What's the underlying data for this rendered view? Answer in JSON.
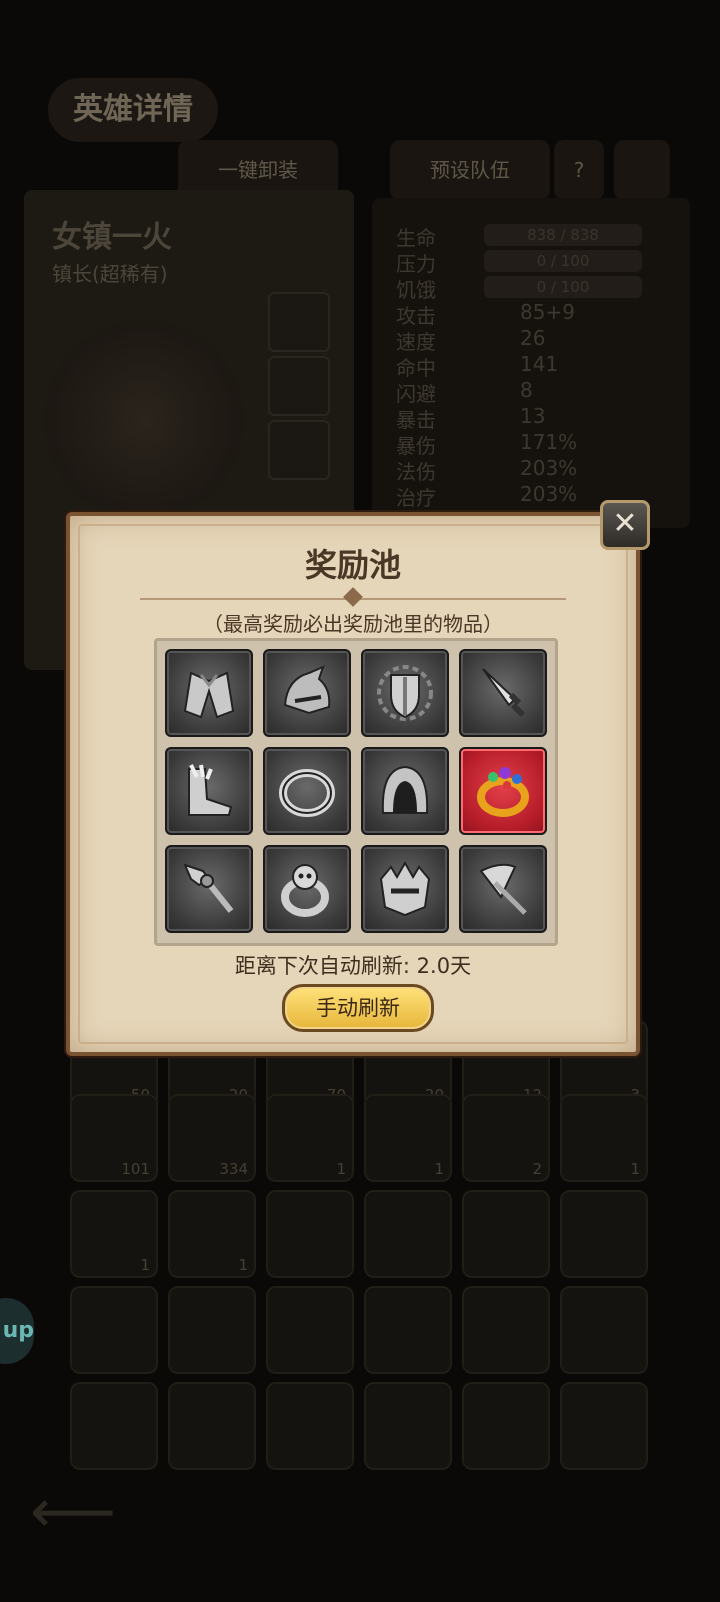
{
  "background": {
    "page_title": "英雄详情",
    "buttons": {
      "equip_all": "一键卸装",
      "preset_team": "预设队伍",
      "help": "?"
    },
    "hero": {
      "name": "女镇一火",
      "rank": "镇长(超稀有)"
    },
    "stats": [
      {
        "label": "生命",
        "value": "838 / 838"
      },
      {
        "label": "压力",
        "value": "0 / 100"
      },
      {
        "label": "饥饿",
        "value": "0 / 100"
      },
      {
        "label": "攻击",
        "value": "85+9"
      },
      {
        "label": "速度",
        "value": "26"
      },
      {
        "label": "命中",
        "value": "141"
      },
      {
        "label": "闪避",
        "value": "8"
      },
      {
        "label": "暴击",
        "value": "13"
      },
      {
        "label": "暴伤",
        "value": "171%"
      },
      {
        "label": "法伤",
        "value": "203%"
      },
      {
        "label": "治疗",
        "value": "203%"
      }
    ],
    "inventory_counts": [
      "50",
      "20",
      "70",
      "20",
      "12",
      "3",
      "101",
      "334",
      "1",
      "1",
      "2",
      "1",
      "1",
      "1"
    ],
    "side_pill": "up"
  },
  "dialog": {
    "title": "奖励池",
    "subtitle": "（最高奖励必出奖励池里的物品）",
    "items": [
      {
        "icon": "cloak-icon",
        "rarity": "gray"
      },
      {
        "icon": "helmet-icon",
        "rarity": "gray"
      },
      {
        "icon": "shield-icon",
        "rarity": "gray"
      },
      {
        "icon": "dagger-icon",
        "rarity": "gray"
      },
      {
        "icon": "boots-icon",
        "rarity": "gray"
      },
      {
        "icon": "ring-icon",
        "rarity": "gray"
      },
      {
        "icon": "hood-icon",
        "rarity": "gray"
      },
      {
        "icon": "gem-ring-icon",
        "rarity": "red"
      },
      {
        "icon": "cross-sword-icon",
        "rarity": "gray"
      },
      {
        "icon": "skull-ring-icon",
        "rarity": "gray"
      },
      {
        "icon": "crown-helmet-icon",
        "rarity": "gray"
      },
      {
        "icon": "axe-icon",
        "rarity": "gray"
      }
    ],
    "refresh_text": "距离下次自动刷新: 2.0天",
    "manual_refresh_label": "手动刷新",
    "close_icon": "crossed-swords-close-icon"
  }
}
